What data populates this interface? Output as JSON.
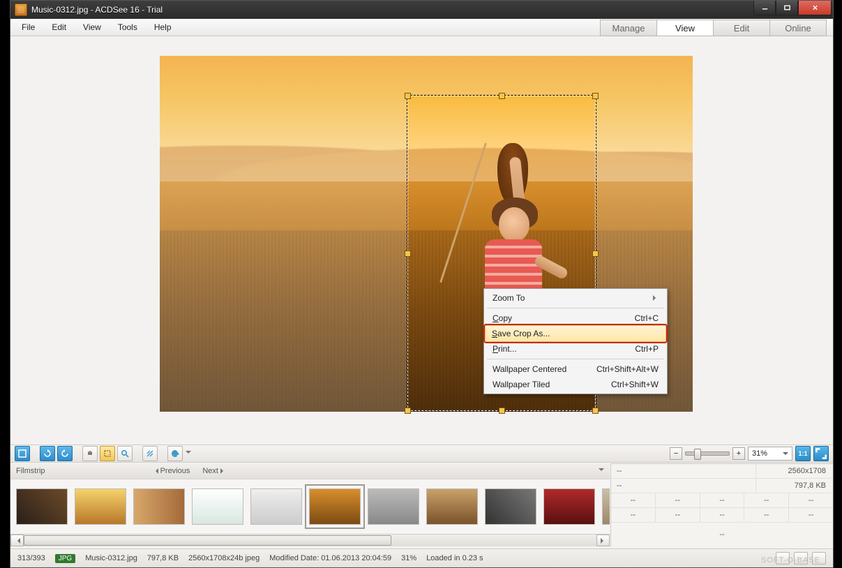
{
  "titlebar": {
    "title": "Music-0312.jpg - ACDSee 16 - Trial"
  },
  "menu": {
    "file": "File",
    "edit": "Edit",
    "view": "View",
    "tools": "Tools",
    "help": "Help"
  },
  "modes": {
    "manage": "Manage",
    "view": "View",
    "edit": "Edit",
    "online": "Online"
  },
  "ctx": {
    "zoom_to": "Zoom To",
    "copy": "Copy",
    "copy_sc": "Ctrl+C",
    "save_crop": "Save Crop As...",
    "print": "Print...",
    "print_sc": "Ctrl+P",
    "wall_c": "Wallpaper Centered",
    "wall_c_sc": "Ctrl+Shift+Alt+W",
    "wall_t": "Wallpaper Tiled",
    "wall_t_sc": "Ctrl+Shift+W"
  },
  "zoom": {
    "percent": "31%"
  },
  "film": {
    "label": "Filmstrip",
    "prev": "Previous",
    "next": "Next"
  },
  "info": {
    "dim": "2560x1708",
    "size": "797,8 KB",
    "dash": "--"
  },
  "status": {
    "count": "313/393",
    "fmt": "JPG",
    "name": "Music-0312.jpg",
    "size": "797,8 KB",
    "dims": "2560x1708x24b jpeg",
    "mod": "Modified Date: 01.06.2013 20:04:59",
    "zoom": "31%",
    "load": "Loaded in 0.23 s"
  },
  "watermark": "SOFT-O-BASE"
}
